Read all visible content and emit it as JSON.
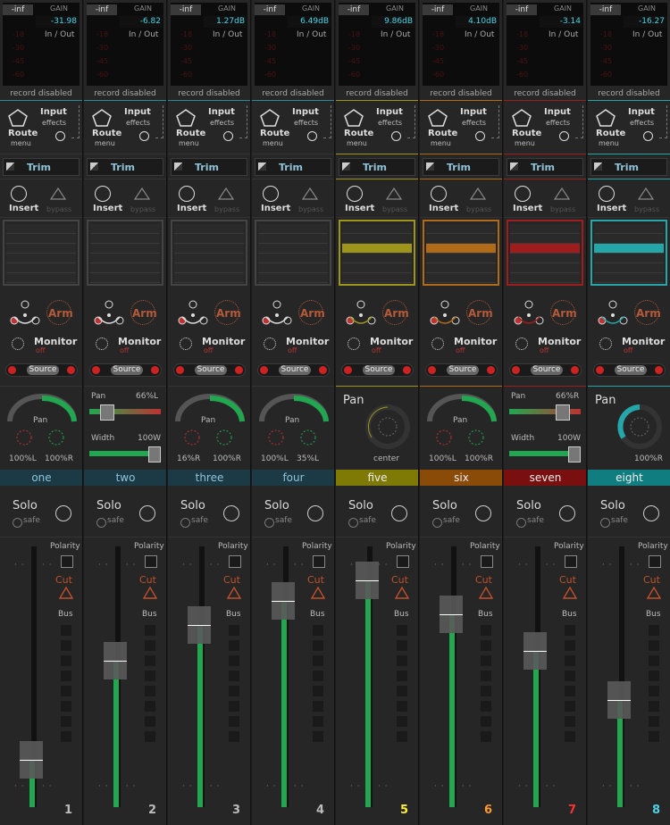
{
  "colors": {
    "meter_text": "#4ad3e6",
    "fader_green": "#21a750",
    "arm": "#b45a3a",
    "cut": "#c0502a"
  },
  "labels": {
    "inf": "-inf",
    "gain": "GAIN",
    "inout": "In / Out",
    "record_disabled": "record disabled",
    "input": "Input",
    "effects": "effects",
    "route": "Route",
    "menu": "menu",
    "trim": "Trim",
    "insert": "Insert",
    "bypass": "bypass",
    "arm": "Arm",
    "monitor": "Monitor",
    "off": "off",
    "source": "Source",
    "pan": "Pan",
    "width": "Width",
    "solo": "Solo",
    "safe": "safe",
    "polarity": "Polarity",
    "cut": "Cut",
    "bus": "Bus",
    "center": "center"
  },
  "meter_scale": [
    "-18",
    "-30",
    "-45",
    "-60"
  ],
  "channels": [
    {
      "name": "one",
      "number": "1",
      "gain": "-31.98",
      "fader": 0.18,
      "color": "#1b3a45",
      "numcolor": "#bbbbbb",
      "pan": {
        "type": "stereo",
        "left": "100%L",
        "right": "100%R"
      }
    },
    {
      "name": "two",
      "number": "2",
      "gain": "-6.82",
      "fader": 0.56,
      "color": "#1b3a45",
      "numcolor": "#bbbbbb",
      "pan": {
        "type": "width",
        "panval": "66%L",
        "widthval": "100W"
      }
    },
    {
      "name": "three",
      "number": "3",
      "gain": "1.27dB",
      "fader": 0.7,
      "color": "#1b3a45",
      "numcolor": "#bbbbbb",
      "pan": {
        "type": "stereo",
        "left": "16%R",
        "right": "100%R"
      }
    },
    {
      "name": "four",
      "number": "4",
      "gain": "6.49dB",
      "fader": 0.79,
      "color": "#1b3a45",
      "numcolor": "#bbbbbb",
      "pan": {
        "type": "stereo",
        "left": "100%L",
        "right": "35%L"
      }
    },
    {
      "name": "five",
      "number": "5",
      "gain": "9.86dB",
      "fader": 0.87,
      "color": "#7f7a05",
      "numcolor": "#ffee33",
      "pan": {
        "type": "mono",
        "label": "center"
      }
    },
    {
      "name": "six",
      "number": "6",
      "gain": "4.10dB",
      "fader": 0.74,
      "color": "#8a4a08",
      "numcolor": "#ff9933",
      "pan": {
        "type": "stereo",
        "left": "100%L",
        "right": "100%R"
      }
    },
    {
      "name": "seven",
      "number": "7",
      "gain": "-3.14",
      "fader": 0.6,
      "color": "#7a0f0f",
      "numcolor": "#ff3030",
      "pan": {
        "type": "width",
        "panval": "66%R",
        "widthval": "100W"
      }
    },
    {
      "name": "eight",
      "number": "8",
      "gain": "-16.27",
      "fader": 0.41,
      "color": "#107e80",
      "numcolor": "#4ad3e6",
      "pan": {
        "type": "mono2",
        "label": "100%R"
      }
    }
  ]
}
